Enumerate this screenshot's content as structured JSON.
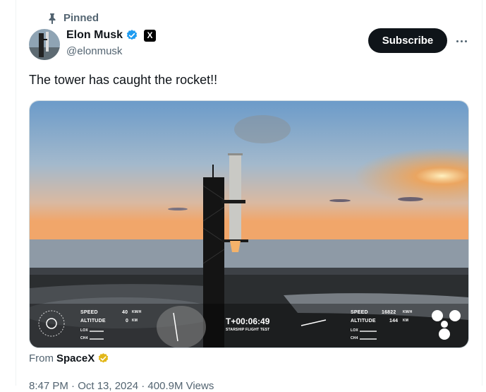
{
  "pinned_label": "Pinned",
  "author": {
    "name": "Elon Musk",
    "handle": "@elonmusk",
    "verified_color": "#1d9bf0",
    "affiliate_badge": "X"
  },
  "subscribe_label": "Subscribe",
  "tweet_text": "The tower has caught the rocket!!",
  "video_hud": {
    "left_booster": {
      "speed_label": "SPEED",
      "speed_value": "40",
      "speed_unit": "KM/H",
      "altitude_label": "ALTITUDE",
      "altitude_value": "0",
      "altitude_unit": "KM",
      "lox_label": "LOX",
      "ch4_label": "CH4"
    },
    "timer": "T+00:06:49",
    "timer_caption": "STARSHIP FLIGHT TEST",
    "right_ship": {
      "speed_label": "SPEED",
      "speed_value": "16822",
      "speed_unit": "KM/H",
      "altitude_label": "ALTITUDE",
      "altitude_value": "144",
      "altitude_unit": "KM",
      "lox_label": "LOX",
      "ch4_label": "CH4"
    }
  },
  "source": {
    "prefix": "From",
    "name": "SpaceX",
    "badge_color": "#e2b719"
  },
  "meta_line": "8:47 PM · Oct 13, 2024 · 400.9M Views",
  "icons": {
    "pin": "pin-icon",
    "verified": "verified-badge-icon",
    "more": "more-icon",
    "gold": "gold-check-icon"
  }
}
